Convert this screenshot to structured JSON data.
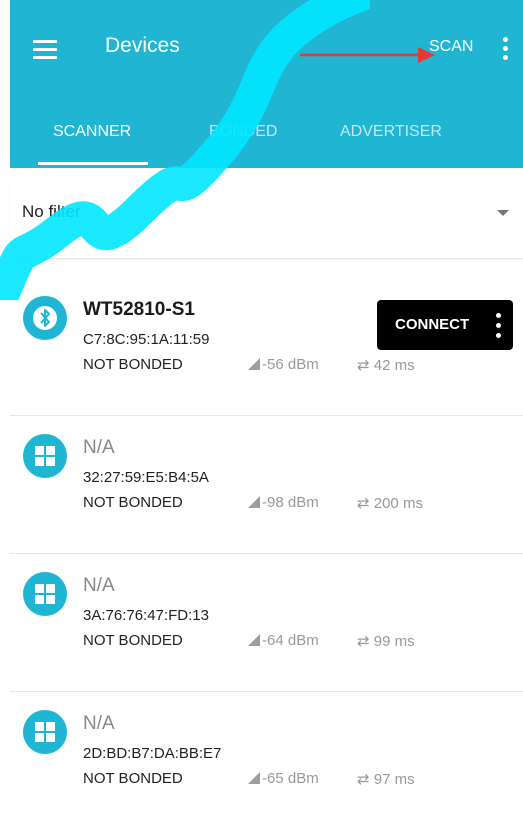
{
  "appbar": {
    "title": "Devices",
    "scan_label": "SCAN",
    "background_color": "#1fb5d3",
    "tabs": [
      {
        "label": "SCANNER",
        "active": true
      },
      {
        "label": "BONDED",
        "active": false
      },
      {
        "label": "ADVERTISER",
        "active": false
      }
    ]
  },
  "filter": {
    "label": "No filter"
  },
  "connect_button": {
    "label": "CONNECT",
    "background_color": "#000000"
  },
  "devices": [
    {
      "name": "WT52810-S1",
      "mac": "C7:8C:95:1A:11:59",
      "bond": "NOT BONDED",
      "rssi": "-56 dBm",
      "interval": "42 ms",
      "icon": "bluetooth-icon"
    },
    {
      "name": "N/A",
      "mac": "32:27:59:E5:B4:5A",
      "bond": "NOT BONDED",
      "rssi": "-98 dBm",
      "interval": "200 ms",
      "icon": "windows-icon"
    },
    {
      "name": "N/A",
      "mac": "3A:76:76:47:FD:13",
      "bond": "NOT BONDED",
      "rssi": "-64 dBm",
      "interval": "99 ms",
      "icon": "windows-icon"
    },
    {
      "name": "N/A",
      "mac": "2D:BD:B7:DA:BB:E7",
      "bond": "NOT BONDED",
      "rssi": "-65 dBm",
      "interval": "97 ms",
      "icon": "windows-icon"
    }
  ],
  "annotation": {
    "arrow_color": "#e53935"
  }
}
